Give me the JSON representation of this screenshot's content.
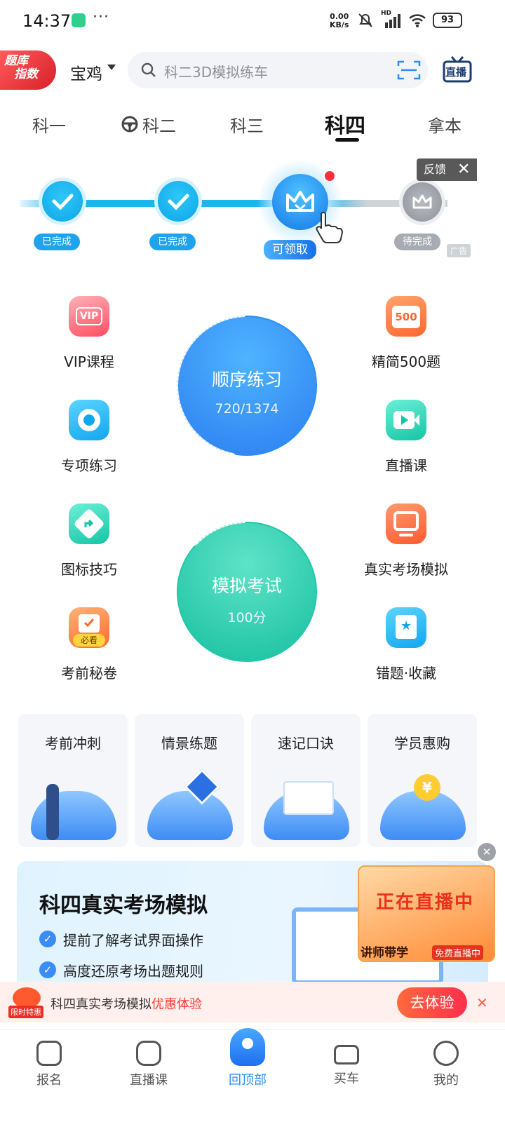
{
  "status_bar": {
    "time": "14:37",
    "net_speed_value": "0.00",
    "net_speed_unit": "KB/s",
    "signal": "HD",
    "battery": "93"
  },
  "header": {
    "badge_line1": "题库",
    "badge_line2": "指数",
    "city": "宝鸡",
    "search_placeholder": "科二3D模拟练车",
    "live_label": "直播"
  },
  "tabs": [
    {
      "label": "科一"
    },
    {
      "label": "科二"
    },
    {
      "label": "科三"
    },
    {
      "label": "科四"
    },
    {
      "label": "拿本"
    }
  ],
  "active_tab": "科四",
  "progress": {
    "steps": [
      {
        "label": "已完成"
      },
      {
        "label": "已完成"
      },
      {
        "label": "可领取"
      },
      {
        "label": "待完成"
      }
    ],
    "feedback": "反馈",
    "ad": "广告"
  },
  "features": {
    "left": [
      {
        "label": "VIP课程"
      },
      {
        "label": "专项练习"
      },
      {
        "label": "图标技巧"
      },
      {
        "label": "考前秘卷",
        "tag": "必看"
      }
    ],
    "right": [
      {
        "label": "精简500题",
        "tag": "500"
      },
      {
        "label": "直播课"
      },
      {
        "label": "真实考场模拟"
      },
      {
        "label": "错题·收藏"
      }
    ],
    "vip_tag": "VIP"
  },
  "practice": {
    "title": "顺序练习",
    "progress_text": "720/1374",
    "done": 720,
    "total": 1374
  },
  "exam": {
    "title": "模拟考试",
    "score": "100分"
  },
  "cards": [
    {
      "title": "考前冲刺"
    },
    {
      "title": "情景练题"
    },
    {
      "title": "速记口诀"
    },
    {
      "title": "学员惠购",
      "coin": "¥"
    }
  ],
  "banner": {
    "title": "科四真实考场模拟",
    "bullets": [
      "提前了解考试界面操作",
      "高度还原考场出题规则"
    ]
  },
  "live_card": {
    "line1": "正在直播中",
    "tag1": "讲师带学",
    "tag2": "免费直播中"
  },
  "promo": {
    "tag": "限时特惠",
    "text": "科四真实考场模拟",
    "highlight": "优惠体验",
    "button": "去体验"
  },
  "bottom_nav": [
    {
      "label": "报名"
    },
    {
      "label": "直播课"
    },
    {
      "label": "回顶部"
    },
    {
      "label": "买车"
    },
    {
      "label": "我的"
    }
  ],
  "colors": {
    "accent": "#2b8ef5",
    "teal": "#1fc9a8",
    "active_nav": "#2b8ef5",
    "red": "#ff3b30"
  }
}
